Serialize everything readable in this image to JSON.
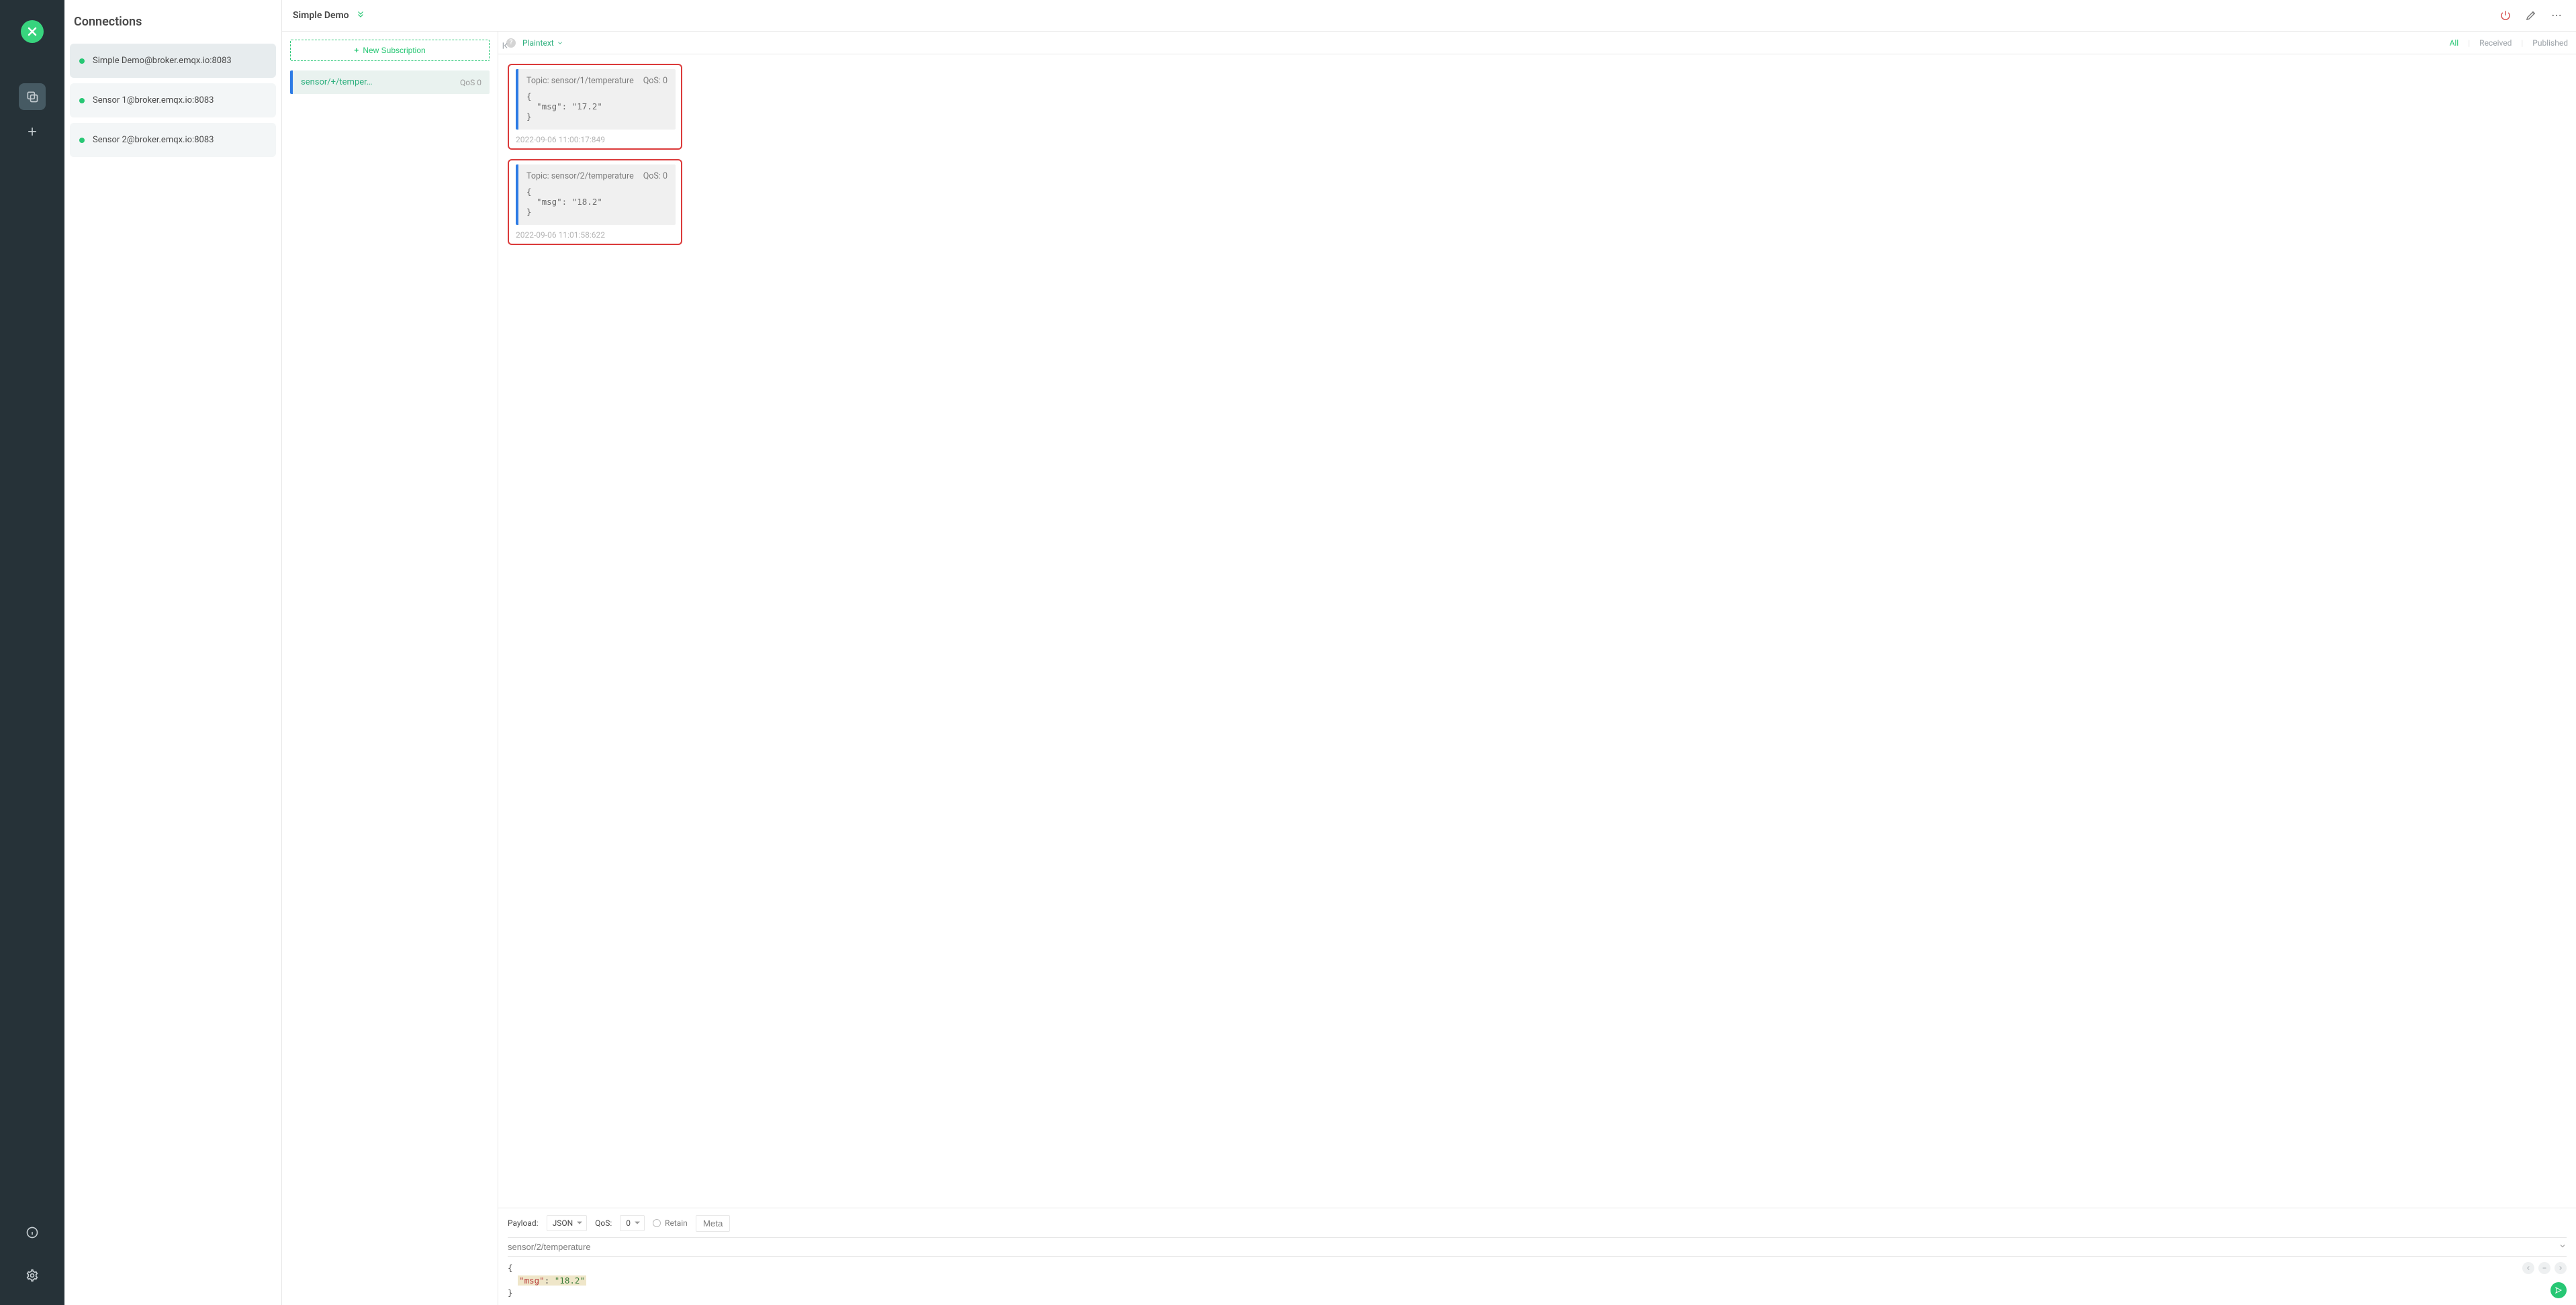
{
  "rail": {
    "logo_alt": "app-logo"
  },
  "connections": {
    "title": "Connections",
    "items": [
      {
        "name": "Simple Demo@broker.emqx.io:8083",
        "active": true
      },
      {
        "name": "Sensor 1@broker.emqx.io:8083",
        "active": false
      },
      {
        "name": "Sensor 2@broker.emqx.io:8083",
        "active": false
      }
    ]
  },
  "detail": {
    "title": "Simple Demo",
    "new_subscription_label": "New Subscription",
    "subscriptions": [
      {
        "name": "sensor/+/temper…",
        "qos": "QoS 0"
      }
    ],
    "format_label": "Plaintext",
    "filters": {
      "all": "All",
      "received": "Received",
      "published": "Published"
    },
    "messages": [
      {
        "topic_label": "Topic: sensor/1/temperature",
        "qos_label": "QoS: 0",
        "body": "{\n  \"msg\": \"17.2\"\n}",
        "timestamp": "2022-09-06 11:00:17:849"
      },
      {
        "topic_label": "Topic: sensor/2/temperature",
        "qos_label": "QoS: 0",
        "body": "{\n  \"msg\": \"18.2\"\n}",
        "timestamp": "2022-09-06 11:01:58:622"
      }
    ],
    "publish": {
      "payload_label": "Payload:",
      "payload_type": "JSON",
      "qos_label": "QoS:",
      "qos_value": "0",
      "retain_label": "Retain",
      "meta_label": "Meta",
      "topic": "sensor/2/temperature",
      "body_key": "\"msg\"",
      "body_val": "\"18.2\""
    }
  }
}
